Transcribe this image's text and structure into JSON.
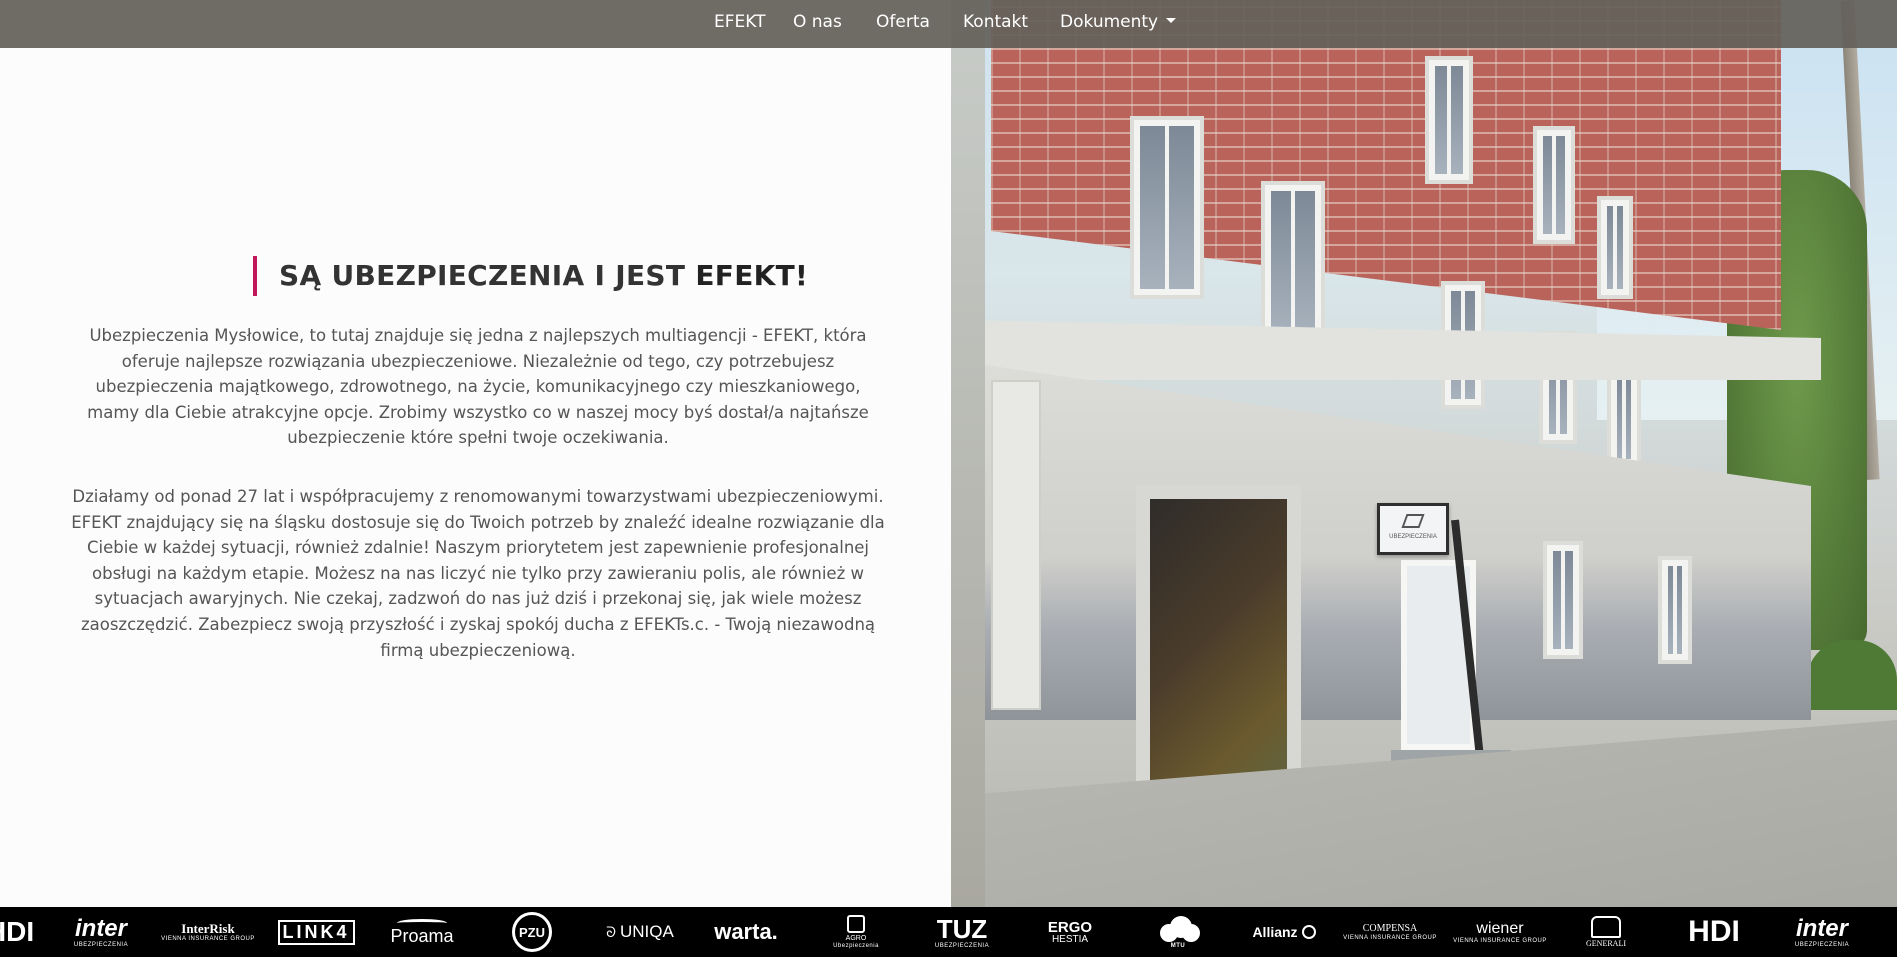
{
  "nav": {
    "items": [
      "EFEKT",
      "O nas",
      "Oferta",
      "Kontakt"
    ],
    "dropdown_label": "Dokumenty"
  },
  "hero": {
    "heading_regular": "SĄ UBEZPIECZENIA I JEST ",
    "heading_bold": "EFEKT!",
    "paragraph1": "Ubezpieczenia Mysłowice, to tutaj znajduje się jedna z najlepszych multiagencji - EFEKT, która oferuje najlepsze rozwiązania ubezpieczeniowe. Niezależnie od tego, czy potrzebujesz ubezpieczenia majątkowego, zdrowotnego, na życie, komunikacyjnego czy mieszkaniowego, mamy dla Ciebie atrakcyjne opcje. Zrobimy wszystko co w naszej mocy byś dostał/a najtańsze ubezpieczenie które spełni twoje oczekiwania.",
    "paragraph2": "Działamy od ponad 27 lat i współpracujemy z renomowanymi towarzystwami ubezpieczeniowymi. EFEKT znajdujący się na śląsku dostosuje się do Twoich potrzeb by znaleźć idealne rozwiązanie dla Ciebie w każdej sytuacji, również zdalnie! Naszym priorytetem jest zapewnienie profesjonalnej obsługi na każdym etapie. Możesz na nas liczyć nie tylko przy zawieraniu polis, ale również w sytuacjach awaryjnych. Nie czekaj, zadzwoń do nas już dziś i przekonaj się, jak wiele możesz zaoszczędzić. Zabezpiecz swoją przyszłość i zyskaj spokój ducha z EFEKTs.c. - Twoją niezawodną firmą ubezpieczeniową."
  },
  "photo": {
    "sign_text": "UBEZPIECZENIA"
  },
  "partners": [
    {
      "name": "HDI",
      "icon": "hdi-logo"
    },
    {
      "name": "inter",
      "sub": "UBEZPIECZENIA",
      "icon": "inter-logo"
    },
    {
      "name": "InterRisk",
      "sub": "VIENNA INSURANCE GROUP",
      "icon": "interrisk-logo"
    },
    {
      "name": "LINK4",
      "icon": "link4-logo"
    },
    {
      "name": "Proama",
      "icon": "proama-logo"
    },
    {
      "name": "PZU",
      "icon": "pzu-logo"
    },
    {
      "name": "UNIQA",
      "icon": "uniqa-logo"
    },
    {
      "name": "warta.",
      "icon": "warta-logo"
    },
    {
      "name": "AGRO",
      "sub": "Ubezpieczenia",
      "icon": "agro-logo"
    },
    {
      "name": "TUZ",
      "sub": "UBEZPIECZENIA",
      "icon": "tuz-logo"
    },
    {
      "name": "ERGO",
      "sub": "HESTIA",
      "icon": "ergo-hestia-logo"
    },
    {
      "name": "MTU",
      "icon": "mtu-logo"
    },
    {
      "name": "Allianz",
      "icon": "allianz-logo"
    },
    {
      "name": "COMPENSA",
      "sub": "VIENNA INSURANCE GROUP",
      "icon": "compensa-logo"
    },
    {
      "name": "wiener",
      "sub": "VIENNA INSURANCE GROUP",
      "icon": "wiener-logo"
    },
    {
      "name": "GENERALI",
      "icon": "generali-logo"
    },
    {
      "name": "HDI",
      "icon": "hdi-logo"
    },
    {
      "name": "inter",
      "sub": "UBEZPIECZENIA",
      "icon": "inter-logo"
    }
  ]
}
